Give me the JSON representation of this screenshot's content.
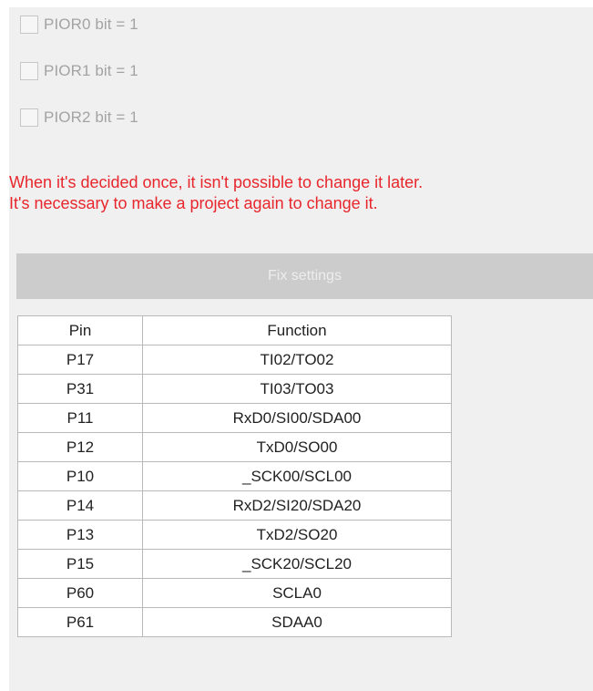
{
  "options": [
    {
      "label": "PIOR0 bit = 1",
      "checked": false,
      "enabled": false
    },
    {
      "label": "PIOR1 bit = 1",
      "checked": false,
      "enabled": false
    },
    {
      "label": "PIOR2 bit = 1",
      "checked": false,
      "enabled": false
    }
  ],
  "warning": {
    "line1": "When it's decided once, it isn't possible to change it later.",
    "line2": "It's necessary to make a project again to change it.",
    "color": "#e8262c"
  },
  "fix_button": {
    "label": "Fix settings",
    "enabled": false
  },
  "pin_table": {
    "headers": {
      "pin": "Pin",
      "function": "Function"
    },
    "rows": [
      {
        "pin": "P17",
        "function": "TI02/TO02"
      },
      {
        "pin": "P31",
        "function": "TI03/TO03"
      },
      {
        "pin": "P11",
        "function": "RxD0/SI00/SDA00"
      },
      {
        "pin": "P12",
        "function": "TxD0/SO00"
      },
      {
        "pin": "P10",
        "function": "_SCK00/SCL00"
      },
      {
        "pin": "P14",
        "function": "RxD2/SI20/SDA20"
      },
      {
        "pin": "P13",
        "function": "TxD2/SO20"
      },
      {
        "pin": "P15",
        "function": "_SCK20/SCL20"
      },
      {
        "pin": "P60",
        "function": "SCLA0"
      },
      {
        "pin": "P61",
        "function": "SDAA0"
      }
    ]
  }
}
